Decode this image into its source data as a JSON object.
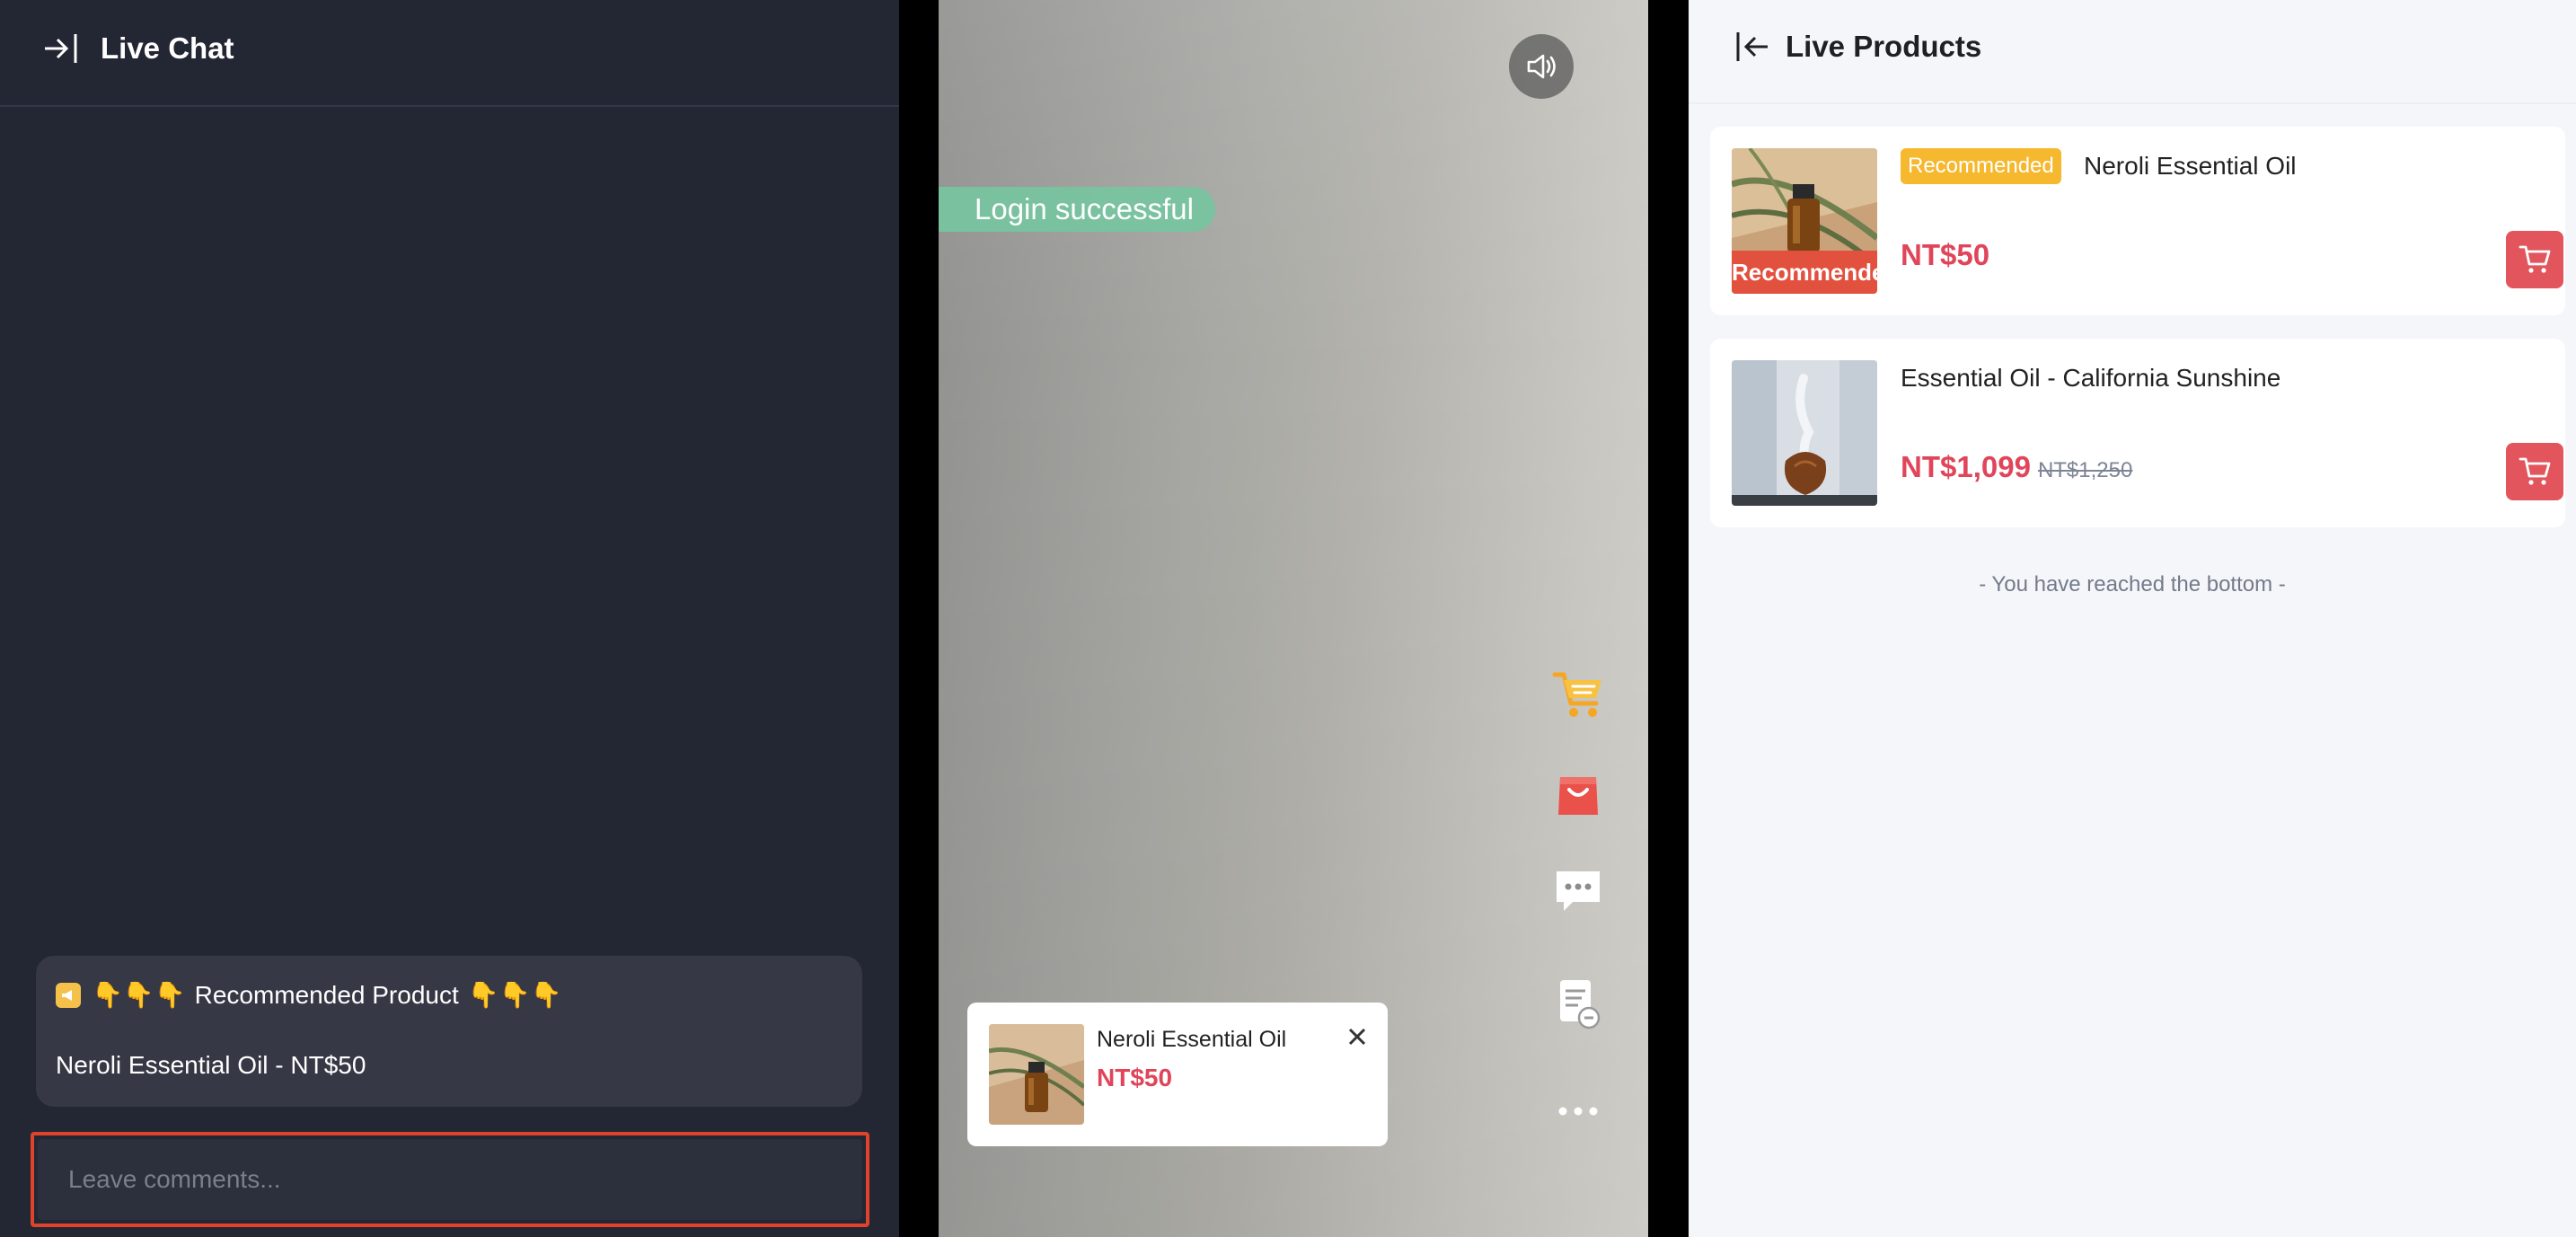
{
  "chat": {
    "title": "Live Chat",
    "pinned": {
      "icon": "megaphone-icon",
      "prefix_emoji": "👇👇👇",
      "heading": "Recommended Product",
      "suffix_emoji": "👇👇👇",
      "body": "Neroli Essential Oil - NT$50"
    },
    "comment_placeholder": "Leave comments..."
  },
  "video": {
    "toast": "Login successful",
    "side_icons": [
      "shopping-cart-icon",
      "shopping-bag-icon",
      "chat-bubble-icon",
      "notes-icon",
      "more-icon"
    ],
    "popup": {
      "name": "Neroli Essential Oil",
      "price": "NT$50"
    }
  },
  "products": {
    "title": "Live Products",
    "items": [
      {
        "badge": "Recommended",
        "thumb_label": "Recommended Product",
        "name": "Neroli Essential Oil",
        "price": "NT$50",
        "old_price": ""
      },
      {
        "badge": "",
        "thumb_label": "",
        "name": "Essential Oil - California Sunshine",
        "price": "NT$1,099",
        "old_price": "NT$1,250"
      }
    ],
    "bottom_note": "- You have reached the bottom -"
  },
  "colors": {
    "chat_bg": "#232633",
    "accent_red": "#e0455a",
    "badge_yellow": "#f5b82e",
    "focus_border": "#e0432b",
    "toast_green": "#76c4a0"
  }
}
